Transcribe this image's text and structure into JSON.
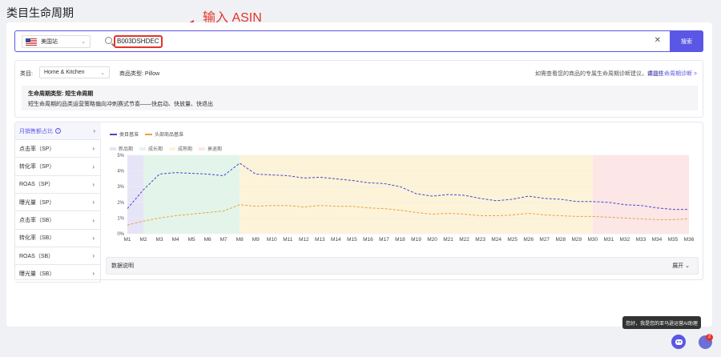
{
  "page": {
    "title": "类目生命周期"
  },
  "annotation": {
    "text": "输入 ASIN"
  },
  "search": {
    "market": "美国站",
    "asin": "B003DSHDEC",
    "button": "搜索"
  },
  "info": {
    "category_label": "类目:",
    "category_value": "Home & Kitchen",
    "product_type": "商品类型: Pillow",
    "hint": "如需查看您的商品的专属生命周期诊断建议，请前往",
    "hint_link": "商品生命周期诊断 >",
    "lifecycle_title": "生命周期类型: 短生命周期",
    "lifecycle_desc": "短生命周期的品类运营策略偏向冲刺赛式节奏——快启动、快放量、快退出"
  },
  "sidebar": {
    "items": [
      {
        "label": "月销售额占比"
      },
      {
        "label": "点击率（SP）"
      },
      {
        "label": "转化率（SP）"
      },
      {
        "label": "ROAS（SP）"
      },
      {
        "label": "曝光量（SP）"
      },
      {
        "label": "点击率（SB）"
      },
      {
        "label": "转化率（SB）"
      },
      {
        "label": "ROAS（SB）"
      },
      {
        "label": "曝光量（SB）"
      }
    ]
  },
  "chart_data": {
    "type": "line",
    "series_legend": [
      "类目基准",
      "头部商品基准"
    ],
    "phase_legend": [
      "新品期",
      "成长期",
      "成熟期",
      "衰退期"
    ],
    "colors": {
      "category": "#4a47c9",
      "top": "#e8a23c",
      "phase_new": "#e6e4f7",
      "phase_growth": "#e3f5ea",
      "phase_mature": "#fdf3d9",
      "phase_decline": "#fce6e6"
    },
    "phases": [
      {
        "name": "新品期",
        "from": "M1",
        "to": "M2"
      },
      {
        "name": "成长期",
        "from": "M2",
        "to": "M8"
      },
      {
        "name": "成熟期",
        "from": "M8",
        "to": "M30"
      },
      {
        "name": "衰退期",
        "from": "M30",
        "to": "M36"
      }
    ],
    "x": [
      "M1",
      "M2",
      "M3",
      "M4",
      "M5",
      "M6",
      "M7",
      "M8",
      "M9",
      "M10",
      "M11",
      "M12",
      "M13",
      "M14",
      "M15",
      "M16",
      "M17",
      "M18",
      "M19",
      "M20",
      "M21",
      "M22",
      "M23",
      "M24",
      "M25",
      "M26",
      "M27",
      "M28",
      "M29",
      "M30",
      "M31",
      "M32",
      "M33",
      "M34",
      "M35",
      "M36"
    ],
    "y_ticks": [
      "0%",
      "1%",
      "2%",
      "3%",
      "4%",
      "5%"
    ],
    "ylim": [
      0,
      5
    ],
    "series": [
      {
        "name": "类目基准",
        "values": [
          1.6,
          2.8,
          3.8,
          3.9,
          3.85,
          3.8,
          3.7,
          4.5,
          3.8,
          3.75,
          3.7,
          3.55,
          3.6,
          3.5,
          3.4,
          3.25,
          3.2,
          3.0,
          2.55,
          2.4,
          2.5,
          2.45,
          2.25,
          2.1,
          2.2,
          2.4,
          2.25,
          2.2,
          2.05,
          2.05,
          2.0,
          1.85,
          1.8,
          1.65,
          1.55,
          1.55
        ]
      },
      {
        "name": "头部商品基准",
        "values": [
          0.55,
          0.8,
          1.0,
          1.15,
          1.25,
          1.35,
          1.45,
          1.85,
          1.75,
          1.8,
          1.8,
          1.7,
          1.8,
          1.75,
          1.75,
          1.65,
          1.6,
          1.5,
          1.35,
          1.25,
          1.3,
          1.25,
          1.15,
          1.15,
          1.2,
          1.3,
          1.2,
          1.15,
          1.1,
          1.1,
          1.05,
          1.0,
          0.95,
          0.9,
          0.9,
          0.95
        ]
      }
    ]
  },
  "data_desc": {
    "label": "数据说明",
    "expand": "展开 ⌄"
  },
  "assistant": {
    "tooltip": "您好，我是您的亚马逊运营AI助理",
    "badge": "2"
  }
}
